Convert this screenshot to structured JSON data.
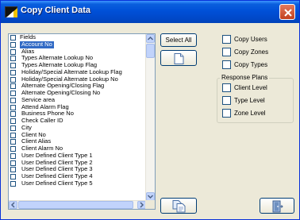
{
  "window": {
    "title": "Copy Client Data"
  },
  "fields_list": {
    "header": "Fields",
    "selected_index": 0,
    "items": [
      "Account No",
      "Alias",
      "Types Alternate Lookup No",
      "Types Alternate Lookup Flag",
      "Holiday/Special Alternate Lookup Flag",
      "Holiday/Special Alternate Lookup No",
      "Alternate Opening/Closing Flag",
      "Alternate Opening/Closing No",
      "Service area",
      "Attend Alarm Flag",
      "Business Phone No",
      "Check Caller ID",
      "City",
      "Client No",
      "Client Alias",
      "Client Alarm No",
      "User Defined Client Type 1",
      "User Defined Client Type 2",
      "User Defined Client Type 3",
      "User Defined Client Type 4",
      "User Defined Client Type 5"
    ]
  },
  "buttons": {
    "select_all": "Select All"
  },
  "options": [
    {
      "label": "Copy Users",
      "checked": false
    },
    {
      "label": "Copy Zones",
      "checked": false
    },
    {
      "label": "Copy Types",
      "checked": false
    }
  ],
  "response_plans": {
    "title": "Response Plans",
    "options": [
      {
        "label": "Client Level",
        "checked": false
      },
      {
        "label": "Type Level",
        "checked": false
      },
      {
        "label": "Zone Level",
        "checked": false
      }
    ]
  },
  "colors": {
    "title_bar": "#0050d8",
    "selection": "#316ac5",
    "dialog_bg": "#ece9d8"
  }
}
